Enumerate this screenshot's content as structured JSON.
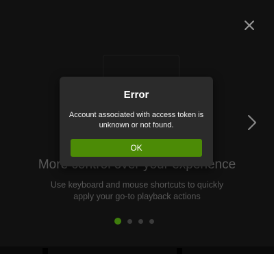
{
  "onboarding": {
    "title": "More control over your experience",
    "subtitle": "Use keyboard and mouse shortcuts to quickly apply your go-to playback actions",
    "page_count": 4,
    "active_page": 1
  },
  "dialog": {
    "title": "Error",
    "message": "Account associated with access token is unknown or not found.",
    "ok_label": "OK"
  },
  "icons": {
    "close": "close-icon",
    "next": "chevron-right-icon"
  },
  "colors": {
    "accent": "#4c8b06",
    "dialog_bg": "#2b2b2b",
    "overlay_bg": "#111111"
  }
}
